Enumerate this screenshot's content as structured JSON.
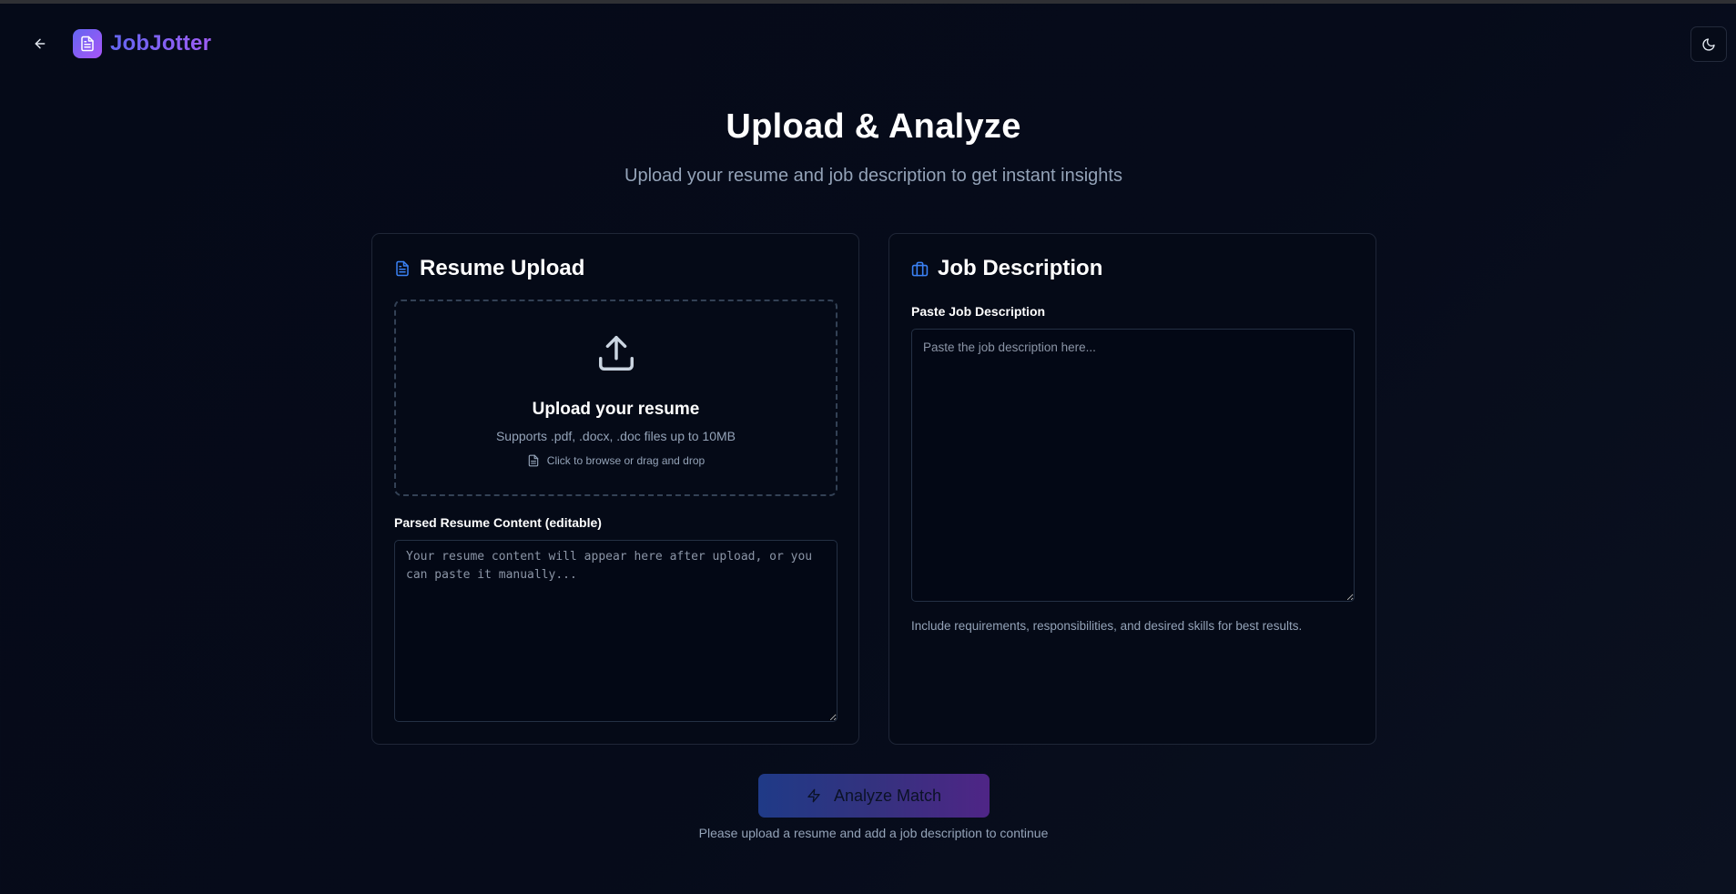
{
  "app": {
    "name": "JobJotter"
  },
  "hero": {
    "title": "Upload & Analyze",
    "subtitle": "Upload your resume and job description to get instant insights"
  },
  "resume_card": {
    "title": "Resume Upload",
    "upload_title": "Upload your resume",
    "upload_support": "Supports .pdf, .docx, .doc files up to 10MB",
    "upload_hint": "Click to browse or drag and drop",
    "parsed_label": "Parsed Resume Content (editable)",
    "parsed_placeholder": "Your resume content will appear here after upload, or you can paste it manually...",
    "parsed_value": ""
  },
  "job_card": {
    "title": "Job Description",
    "field_label": "Paste Job Description",
    "placeholder": "Paste the job description here...",
    "value": "",
    "helper": "Include requirements, responsibilities, and desired skills for best results."
  },
  "action": {
    "button_label": "Analyze Match",
    "hint": "Please upload a resume and add a job description to continue"
  },
  "icons": {
    "back": "arrow-left-icon",
    "logo": "file-text-icon",
    "theme": "moon-icon",
    "resume": "file-text-icon",
    "job": "briefcase-icon",
    "upload": "upload-icon",
    "hint": "file-icon",
    "analyze": "zap-icon"
  },
  "colors": {
    "background": "#050a18",
    "accent_start": "#6366f1",
    "accent_end": "#a855f7",
    "card_border": "#1f2637",
    "muted_text": "#94a3b8"
  }
}
